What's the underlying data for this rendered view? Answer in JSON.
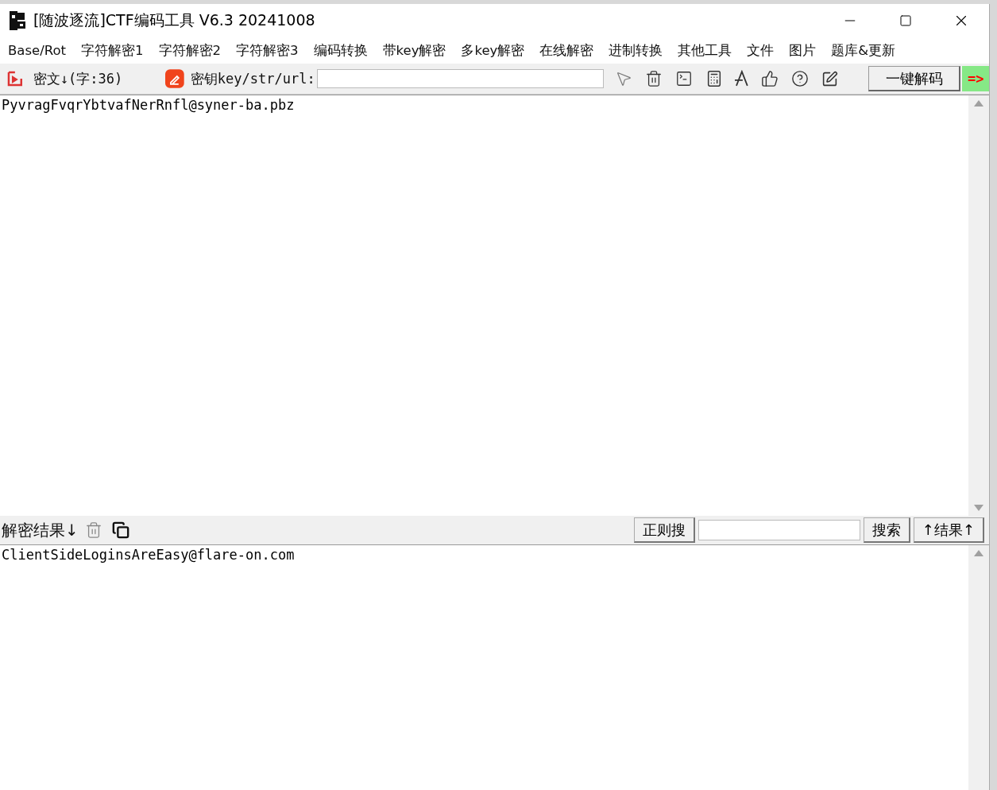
{
  "window": {
    "title": "[随波逐流]CTF编码工具 V6.3 20241008"
  },
  "menu": [
    "Base/Rot",
    "字符解密1",
    "字符解密2",
    "字符解密3",
    "编码转换",
    "带key解密",
    "多key解密",
    "在线解密",
    "进制转换",
    "其他工具",
    "文件",
    "图片",
    "题库&更新"
  ],
  "toolbar": {
    "cipher_label": "密文↓(字:36)",
    "key_label": "密钥key/str/url:",
    "decode_button": "一键解码",
    "arrow_button": "=>"
  },
  "input": {
    "text": "PyvragFvqrYbtvafNerRnfl@syner-ba.pbz"
  },
  "result_bar": {
    "label": "解密结果↓",
    "regex_button": "正则搜",
    "search_button": "搜索",
    "result_button": "↑结果↑"
  },
  "output": {
    "text": "ClientSideLoginsAreEasy@flare-on.com"
  }
}
